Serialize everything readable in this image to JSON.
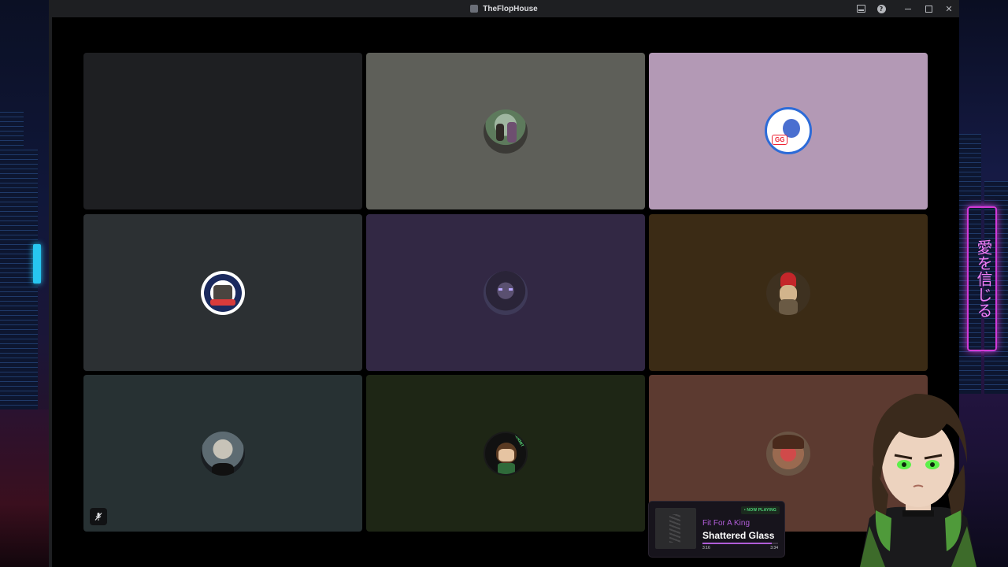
{
  "window": {
    "title": "TheFlopHouse"
  },
  "titlebar_controls": [
    {
      "name": "inbox-icon"
    },
    {
      "name": "help-icon",
      "glyph": "?"
    },
    {
      "name": "minimize-icon"
    },
    {
      "name": "maximize-icon"
    },
    {
      "name": "close-icon",
      "glyph": "✕"
    }
  ],
  "tiles": [
    {
      "id": "tile-1",
      "bg": "#1e1f22",
      "has_avatar": false
    },
    {
      "id": "tile-2",
      "bg": "#5e5f59",
      "has_avatar": true,
      "avatar": "photo-avatar"
    },
    {
      "id": "tile-3",
      "bg": "#b399b5",
      "has_avatar": true,
      "avatar": "cartoon-avatar",
      "avatar_text": "GG"
    },
    {
      "id": "tile-4",
      "bg": "#2c3033",
      "has_avatar": true,
      "avatar": "logo-avatar"
    },
    {
      "id": "tile-5",
      "bg": "#322844",
      "has_avatar": true,
      "avatar": "creature-avatar"
    },
    {
      "id": "tile-6",
      "bg": "#3b2b15",
      "has_avatar": true,
      "avatar": "character-avatar"
    },
    {
      "id": "tile-7",
      "bg": "#273133",
      "has_avatar": true,
      "avatar": "portrait-avatar",
      "muted": true
    },
    {
      "id": "tile-8",
      "bg": "#1e2615",
      "has_avatar": true,
      "avatar": "anime-avatar",
      "avatar_text": "KERMIT"
    },
    {
      "id": "tile-9",
      "bg": "#5c3a30",
      "has_avatar": true,
      "avatar": "selfie-avatar"
    }
  ],
  "now_playing": {
    "badge": "• NOW PLAYING",
    "artist": "Fit For A King",
    "track": "Shattered Glass",
    "elapsed": "3:16",
    "duration": "3:34",
    "progress_fraction": 0.916,
    "accent": "#b05dd8",
    "badge_color": "#4fd67a"
  },
  "backdrop": {
    "neon_sign_text": "愛を信じる"
  }
}
